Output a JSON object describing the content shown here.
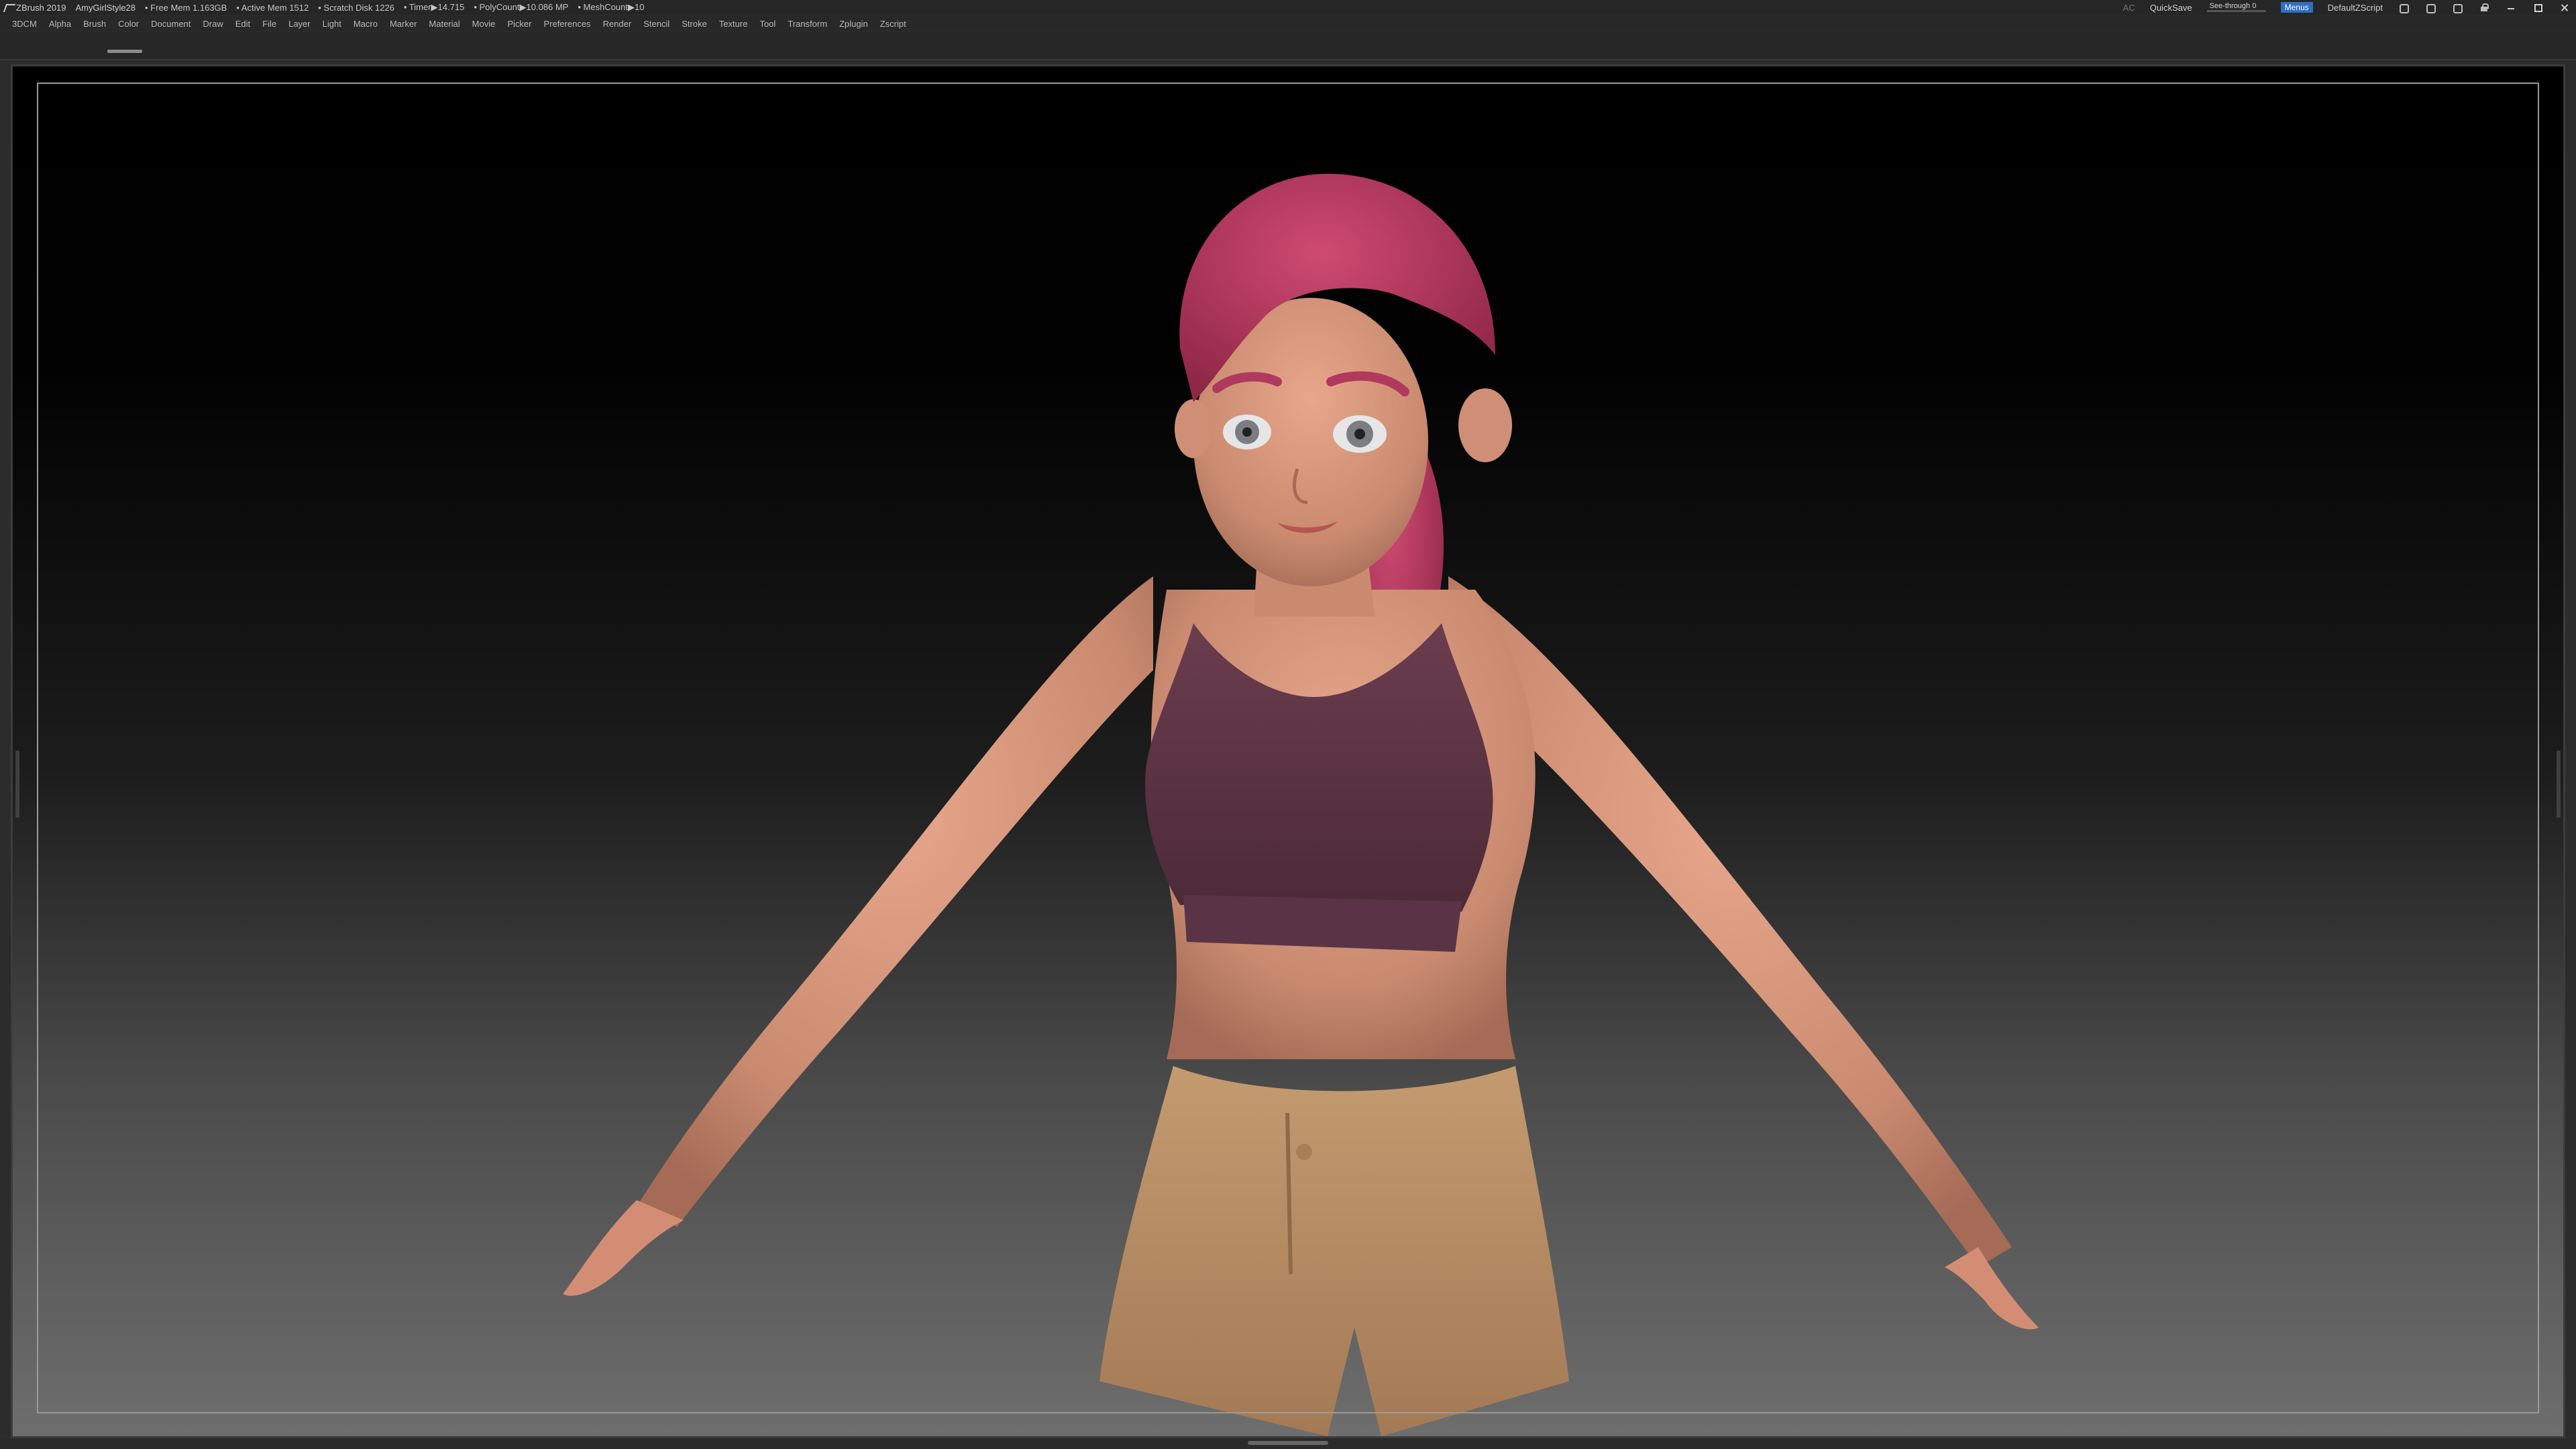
{
  "titlebar": {
    "app": "ZBrush 2019",
    "project": "AmyGirlStyle28",
    "free_mem": "• Free Mem 1.163GB",
    "active_mem": "• Active Mem 1512",
    "scratch_disk": "• Scratch Disk 1226",
    "timer": "• Timer▶14.715",
    "polycount": "• PolyCount▶10.086 MP",
    "meshcount": "• MeshCount▶10",
    "ac": "AC",
    "quicksave": "QuickSave",
    "see_through": "See-through 0",
    "see_through_level": 0,
    "menus": "Menus",
    "script": "DefaultZScript"
  },
  "menubar": {
    "items": [
      "3DCM",
      "Alpha",
      "Brush",
      "Color",
      "Document",
      "Draw",
      "Edit",
      "File",
      "Layer",
      "Light",
      "Macro",
      "Marker",
      "Material",
      "Movie",
      "Picker",
      "Preferences",
      "Render",
      "Stencil",
      "Stroke",
      "Texture",
      "Tool",
      "Transform",
      "Zplugin",
      "Zscript"
    ]
  },
  "icons": {
    "app_logo": "zbrush-logo-icon",
    "window_controls": [
      "minimize-icon",
      "maximize-icon",
      "close-icon"
    ]
  },
  "colors": {
    "accent": "#2e6fc2",
    "see_through_fill": "#e89a3c",
    "hair": "#b83a62",
    "skin": "#d6947a",
    "top": "#5a3444",
    "shorts": "#b58a62"
  }
}
